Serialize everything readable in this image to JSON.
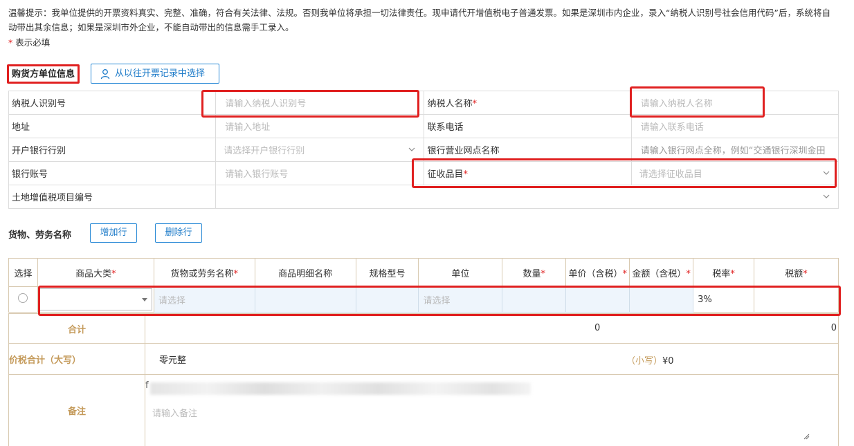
{
  "notice": {
    "text": "温馨提示：我单位提供的开票资料真实、完整、准确，符合有关法律、法规。否则我单位将承担一切法律责任。现申请代开增值税电子普通发票。如果是深圳市内企业，录入“纳税人识别号社会信用代码”后，系统将自动带出其余信息；如果是深圳市外企业，不能自动带出的信息需手工录入。",
    "required_star": "*",
    "required_label": " 表示必填"
  },
  "buyer": {
    "title": "购货方单位信息",
    "history_button": "从以往开票记录中选择",
    "rows": [
      {
        "l1": "纳税人识别号",
        "v1": "请输入纳税人识别号",
        "l2": "纳税人名称",
        "l2_star": "*",
        "v2": "请输入纳税人名称"
      },
      {
        "l1": "地址",
        "v1": "请输入地址",
        "l2": "联系电话",
        "l2_star": "",
        "v2": "请输入联系电话"
      },
      {
        "l1": "开户银行行别",
        "v1": "请选择开户银行行别",
        "l2": "银行营业网点名称",
        "l2_star": "",
        "v2": "请输入银行网点全称，例如“交通银行深圳金田"
      },
      {
        "l1": "银行账号",
        "v1": "请输入银行账号",
        "l2": "征收品目",
        "l2_star": "*",
        "v2": "请选择征收品目"
      },
      {
        "l1": "土地增值税项目编号",
        "v1": ""
      }
    ]
  },
  "goods": {
    "label": "货物、劳务名称",
    "add_button": "增加行",
    "delete_button": "删除行",
    "star": "*",
    "headers": [
      "选择",
      "商品大类",
      "货物或劳务名称",
      "商品明细名称",
      "规格型号",
      "单位",
      "数量",
      "单价（含税）",
      "金额（含税）",
      "税率",
      "税额"
    ],
    "required_cols": [
      false,
      true,
      true,
      false,
      false,
      false,
      true,
      true,
      true,
      true,
      true
    ],
    "row": {
      "category": "",
      "name_placeholder": "请选择",
      "unit_placeholder": "请选择",
      "tax_rate": "3%"
    }
  },
  "summary": {
    "total_label": "合计",
    "total_amount": "0",
    "total_tax": "0",
    "upper_label": "价税合计（大写）",
    "upper_value": "零元整",
    "lower_label": "（小写）",
    "lower_value": "¥0",
    "remark_label": "备注",
    "remark_prefix": "f",
    "remark_placeholder": "请输入备注"
  }
}
